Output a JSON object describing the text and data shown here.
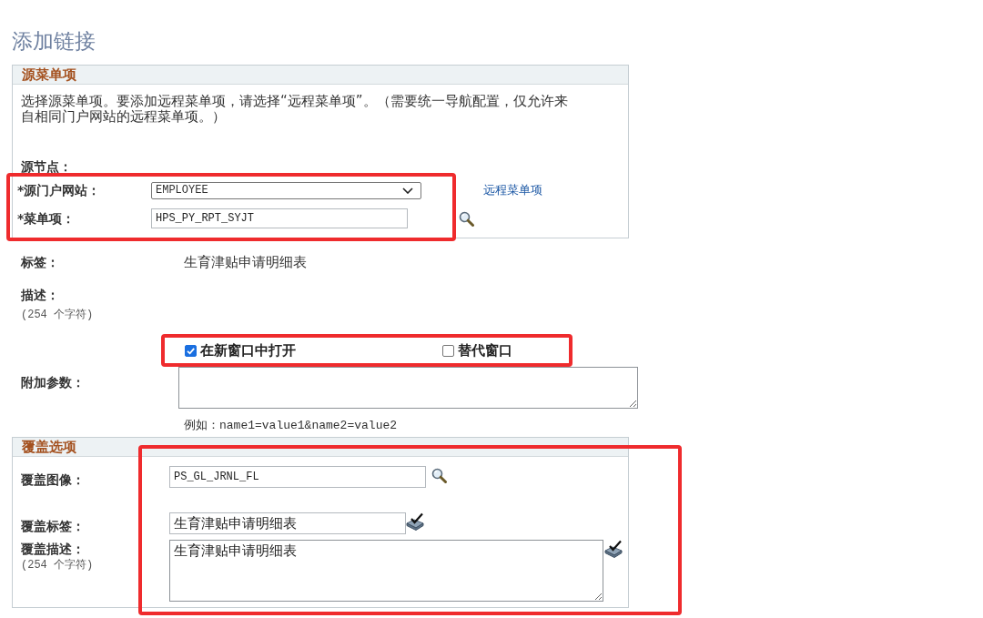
{
  "page_title": "添加链接",
  "source_section": {
    "title": "源菜单项",
    "description": "选择源菜单项。要添加远程菜单项，请选择“远程菜单项”。（需要统一导航配置，仅允许来自相同门户网站的远程菜单项。）",
    "node_label": "源节点：",
    "fields": [
      {
        "kind": "select",
        "label": "*源门户网站：",
        "value": "EMPLOYEE"
      },
      {
        "kind": "lookup",
        "label": "*菜单项：",
        "value": "HPS_PY_RPT_SYJT"
      }
    ],
    "remote_link": "远程菜单项",
    "fields_highlighted": true
  },
  "label_field": {
    "label": "标签：",
    "value": "生育津贴申请明细表"
  },
  "description_field": {
    "label": "描述：",
    "hint": "(254 个字符)"
  },
  "options": {
    "highlighted": true,
    "items": [
      {
        "label": "在新窗口中打开",
        "checked": true
      },
      {
        "label": "替代窗口",
        "checked": false
      }
    ]
  },
  "additional_params": {
    "label": "附加参数：",
    "example": "例如：name1=value1&name2=value2"
  },
  "override_section": {
    "title": "覆盖选项",
    "highlighted": true,
    "fields": [
      {
        "kind": "lookup",
        "label": "覆盖图像：",
        "value": "PS_GL_JRNL_FL"
      },
      {
        "kind": "translate",
        "label": "覆盖标签：",
        "value": "生育津贴申请明细表"
      },
      {
        "kind": "translate_area",
        "label": "覆盖描述：",
        "hint": "(254 个字符)",
        "value": "生育津贴申请明细表"
      }
    ]
  }
}
